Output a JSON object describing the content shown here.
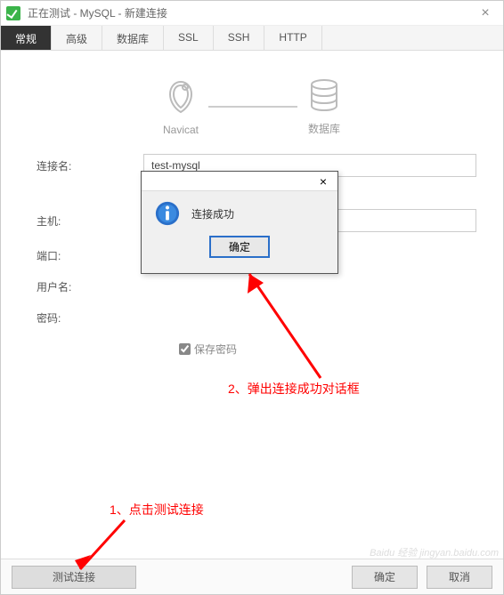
{
  "titlebar": {
    "text": "正在测试 - MySQL - 新建连接",
    "close": "×"
  },
  "tabs": {
    "items": [
      {
        "label": "常规"
      },
      {
        "label": "高级"
      },
      {
        "label": "数据库"
      },
      {
        "label": "SSL"
      },
      {
        "label": "SSH"
      },
      {
        "label": "HTTP"
      }
    ]
  },
  "connector": {
    "left_label": "Navicat",
    "right_label": "数据库"
  },
  "form": {
    "connection_name_label": "连接名:",
    "connection_name_value": "test-mysql",
    "host_label": "主机:",
    "host_value": "",
    "port_label": "端口:",
    "port_value": "",
    "username_label": "用户名:",
    "username_value": "",
    "password_label": "密码:",
    "password_value": "",
    "save_password_label": "保存密码"
  },
  "footer": {
    "test_label": "测试连接",
    "ok_label": "确定",
    "cancel_label": "取消"
  },
  "modal": {
    "close": "×",
    "message": "连接成功",
    "ok_label": "确定"
  },
  "annotations": {
    "anno1": "1、点击测试连接",
    "anno2": "2、弹出连接成功对话框"
  },
  "watermark": "Baidu 经验 jingyan.baidu.com"
}
